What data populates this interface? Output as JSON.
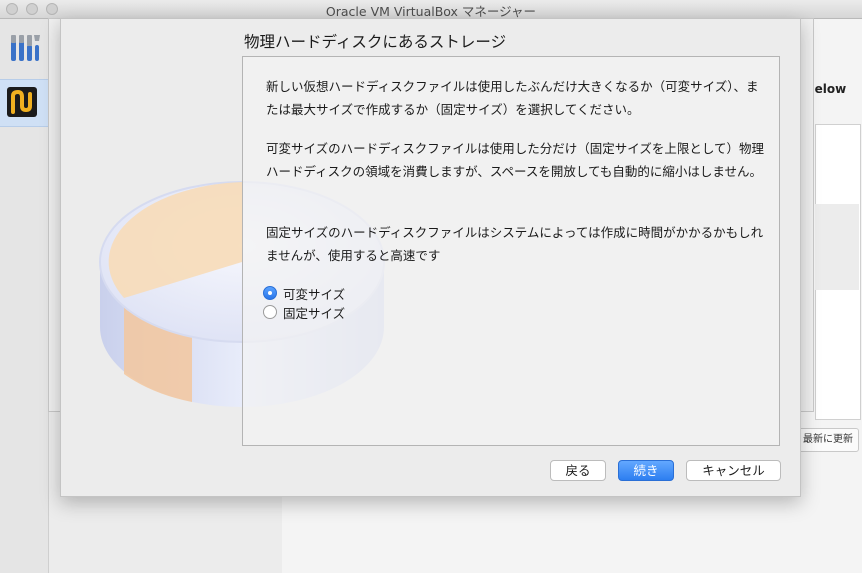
{
  "window": {
    "title": "Oracle VM VirtualBox マネージャー"
  },
  "background": {
    "right_header_fragment": "below",
    "update_button_fragment": "最新に更新"
  },
  "dialog": {
    "title": "物理ハードディスクにあるストレージ",
    "paragraphs": [
      "新しい仮想ハードディスクファイルは使用したぶんだけ大きくなるか（可変サイズ）、または最大サイズで作成するか（固定サイズ）を選択してください。",
      "可変サイズのハードディスクファイルは使用した分だけ（固定サイズを上限として）物理ハードディスクの領域を消費しますが、スペースを開放しても自動的に縮小はしません。",
      "固定サイズのハードディスクファイルはシステムによっては作成に時間がかかるかもしれませんが、使用すると高速です"
    ],
    "options": [
      {
        "label": "可変サイズ",
        "selected": true
      },
      {
        "label": "固定サイズ",
        "selected": false
      }
    ],
    "buttons": {
      "back": "戻る",
      "continue": "続き",
      "cancel": "キャンセル"
    }
  },
  "colors": {
    "accent": "#2d7ef0",
    "selection": "#cfe0f5"
  },
  "icons": {
    "close": "close-icon",
    "tools": "tools-icon",
    "vm": "vm-icon",
    "disk": "hard-disk-icon"
  }
}
